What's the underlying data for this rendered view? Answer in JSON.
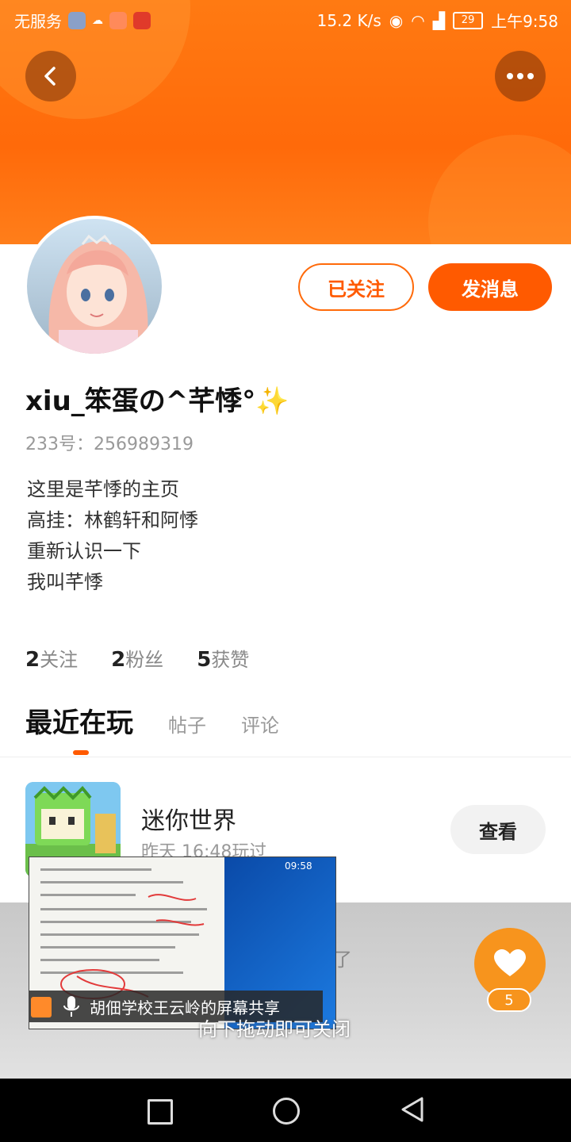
{
  "status_bar": {
    "carrier": "无服务",
    "speed": "15.2 K/s",
    "battery": "29",
    "time": "上午9:58"
  },
  "profile": {
    "username": "xiu_笨蛋の^芊悸°✨",
    "id_line": "233号：256989319",
    "bio": [
      "这里是芊悸的主页",
      "高挂：林鹤轩和阿悸",
      "重新认识一下",
      "我叫芊悸"
    ],
    "stats": [
      {
        "count": "2",
        "label": "关注"
      },
      {
        "count": "2",
        "label": "粉丝"
      },
      {
        "count": "5",
        "label": "获赞"
      }
    ]
  },
  "actions": {
    "follow_label": "已关注",
    "message_label": "发消息"
  },
  "tabs": {
    "active": "最近在玩",
    "items": [
      "帖子",
      "评论"
    ]
  },
  "games": [
    {
      "name": "迷你世界",
      "time": "昨天 16:48玩过",
      "button": "查看"
    }
  ],
  "faded_row": {
    "text": "了"
  },
  "like": {
    "count": "5"
  },
  "screen_share": {
    "title": "胡佃学校王云岭的屏幕共享",
    "clock": "09:58",
    "hint": "向下拖动即可关闭"
  },
  "icons": {
    "back": "chevron-left-icon",
    "more": "more-dots-icon",
    "like": "heart-icon",
    "nav_recent": "square-icon",
    "nav_home": "circle-icon",
    "nav_back": "triangle-back-icon"
  },
  "colors": {
    "accent": "#ff5a00",
    "header": "#ff7a12",
    "like": "#f7941d"
  }
}
